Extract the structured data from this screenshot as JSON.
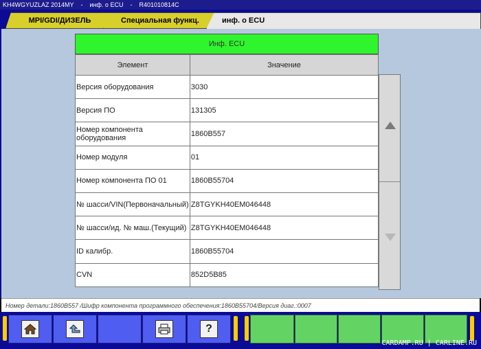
{
  "titlebar": {
    "vin": "KH4WGYUZLAZ 2014MY",
    "sep1": "-",
    "screen": "инф. о ECU",
    "sep2": "-",
    "part": "R401010814C"
  },
  "tabs": [
    {
      "label": "MPI/GDI/ДИЗЕЛЬ"
    },
    {
      "label": "Специальная функц."
    },
    {
      "label": "инф. о ECU"
    }
  ],
  "panel": {
    "title": "Инф. ECU",
    "columns": [
      "Элемент",
      "Значение"
    ],
    "rows": [
      {
        "item": "Версия оборудования",
        "value": "3030"
      },
      {
        "item": "Версия ПО",
        "value": "131305"
      },
      {
        "item": "Номер компонента оборудования",
        "value": "1860B557"
      },
      {
        "item": "Номер модуля",
        "value": "01"
      },
      {
        "item": "Номер компонента ПО 01",
        "value": "1860B55704"
      },
      {
        "item": "№ шасси/VIN(Первоначальный)",
        "value": "Z8TGYKH40EM046448"
      },
      {
        "item": "№ шасси/ид. № маш.(Текущий)",
        "value": "Z8TGYKH40EM046448"
      },
      {
        "item": "ID калибр.",
        "value": "1860B55704"
      },
      {
        "item": "CVN",
        "value": "852D5B85"
      }
    ]
  },
  "status": {
    "text": "Номер детали:1860B557  /Шифр компонента программного обеспечения:1860B55704/Версия диаг.:0007"
  },
  "toolbar": {
    "home_icon": "home-icon",
    "back_icon": "back-arrow-icon",
    "print_icon": "printer-icon",
    "help_label": "?"
  },
  "watermark": "CARDAMP.RU | CARLINE.RU",
  "colors": {
    "title_bar": "#1c1c8c",
    "frame": "#0b0b95",
    "background": "#b6c8dd",
    "panel_header": "#2ff52d",
    "tab_active": "#d8cf2a",
    "toolbar_button": "#4f5df0",
    "function_key": "#63d463"
  }
}
